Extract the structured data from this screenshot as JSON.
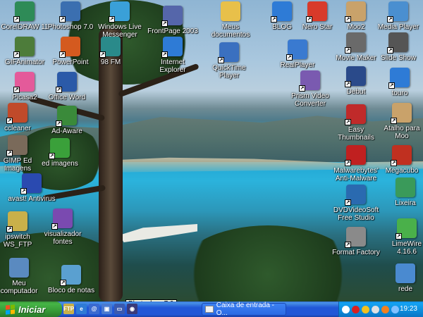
{
  "desktop": {
    "icons": [
      {
        "label": "CorelDRAW 11",
        "icon": "coreldraw-icon",
        "color": "#2e8b57"
      },
      {
        "label": "Photoshop 7.0",
        "icon": "photoshop-icon",
        "color": "#3b6fb0"
      },
      {
        "label": "Windows Live\nMessenger",
        "icon": "messenger-icon",
        "color": "#3aa0d8"
      },
      {
        "label": "FrontPage 2003",
        "icon": "frontpage-icon",
        "color": "#5566aa"
      },
      {
        "label": "Meus\ndocumentos",
        "icon": "folder-icon",
        "color": "#e8c04a"
      },
      {
        "label": "BLOG",
        "icon": "ie-icon",
        "color": "#2e7bd6"
      },
      {
        "label": "Nero Star",
        "icon": "nero-icon",
        "color": "#d83a2a"
      },
      {
        "label": "Moo2",
        "icon": "cow-icon",
        "color": "#c9a26a"
      },
      {
        "label": "Media Player",
        "icon": "media-player-icon",
        "color": "#4a8fd0"
      },
      {
        "label": "GIFAnimator",
        "icon": "gifanimator-icon",
        "color": "#4d7c3a"
      },
      {
        "label": "PowerPoint",
        "icon": "powerpoint-icon",
        "color": "#d45a1f"
      },
      {
        "label": "98 FM",
        "icon": "radio-icon",
        "color": "#2a8a8a"
      },
      {
        "label": "Internet\nExplorer",
        "icon": "internet-explorer-icon",
        "color": "#2e7bd6"
      },
      {
        "label": "QuickTime\nPlayer",
        "icon": "quicktime-icon",
        "color": "#3a70c0"
      },
      {
        "label": "RealPlayer",
        "icon": "realplayer-icon",
        "color": "#3a7ad0"
      },
      {
        "label": "Movie Maker",
        "icon": "movie-maker-icon",
        "color": "#6a6a6a"
      },
      {
        "label": "Slide Show",
        "icon": "slideshow-icon",
        "color": "#555555"
      },
      {
        "label": "Picasa2",
        "icon": "picasa-icon",
        "color": "#e45a9a"
      },
      {
        "label": "Office Word",
        "icon": "word-icon",
        "color": "#2b5aa8"
      },
      {
        "label": "Prism Video\nConverter",
        "icon": "prism-icon",
        "color": "#7a5ab0"
      },
      {
        "label": "Debut",
        "icon": "debut-icon",
        "color": "#2a4a8a"
      },
      {
        "label": "touro",
        "icon": "ie-icon",
        "color": "#2e7bd6"
      },
      {
        "label": "ccleaner",
        "icon": "ccleaner-icon",
        "color": "#c04a2a"
      },
      {
        "label": "Ad-Aware",
        "icon": "adaware-icon",
        "color": "#3a8a3a"
      },
      {
        "label": "Easy\nThumbnails",
        "icon": "thumbnails-icon",
        "color": "#c02a2a"
      },
      {
        "label": "Atalho para\nMoo",
        "icon": "cow-icon",
        "color": "#c9a26a"
      },
      {
        "label": "GIMP Ed\nImagens",
        "icon": "gimp-icon",
        "color": "#7a6a5a"
      },
      {
        "label": "ed imagens",
        "icon": "ed-imagens-icon",
        "color": "#3aa03a"
      },
      {
        "label": "Malwarebytes'\nAnti-Malware",
        "icon": "malwarebytes-icon",
        "color": "#c02020"
      },
      {
        "label": "Megacubo",
        "icon": "megacubo-icon",
        "color": "#c03020"
      },
      {
        "label": "avast! Antivirus",
        "icon": "avast-icon",
        "color": "#2a4ab0"
      },
      {
        "label": "DVDVideoSoft\nFree Studio",
        "icon": "dvdvideosoft-icon",
        "color": "#2a6ab0"
      },
      {
        "label": "Lixeira",
        "icon": "recycle-bin-icon",
        "color": "#3a9a5a"
      },
      {
        "label": "ipswitch\nWS_FTP",
        "icon": "ftp-icon",
        "color": "#c9b04a"
      },
      {
        "label": "visualizador\nfontes",
        "icon": "fonts-viewer-icon",
        "color": "#7a4ab0"
      },
      {
        "label": "Format Factory",
        "icon": "format-factory-icon",
        "color": "#8a8a8a"
      },
      {
        "label": "LimeWire\n4.16.6",
        "icon": "limewire-icon",
        "color": "#4ab04a"
      },
      {
        "label": "Meu\ncomputador",
        "icon": "my-computer-icon",
        "color": "#5a8ac0"
      },
      {
        "label": "Bloco de notas",
        "icon": "notepad-icon",
        "color": "#5aa0d0"
      },
      {
        "label": "rede",
        "icon": "network-icon",
        "color": "#4a8ad0"
      }
    ]
  },
  "taskbar": {
    "start_label": "Iniciar",
    "task_label": "Caixa de entrada - O...",
    "clock": "19:23",
    "tooltip": "Photoshop 7.0",
    "quicklaunch": [
      {
        "icon": "ftp-quicklaunch-icon",
        "text": "FTP",
        "color": "#c9b04a"
      },
      {
        "icon": "ie-quicklaunch-icon",
        "text": "e",
        "color": "#2e7bd6"
      },
      {
        "icon": "outlook-quicklaunch-icon",
        "text": "@",
        "color": "#3a6ad0"
      },
      {
        "icon": "window-quicklaunch-icon",
        "text": "▣",
        "color": "#4a7ad0"
      },
      {
        "icon": "desktop-quicklaunch-icon",
        "text": "▭",
        "color": "#3a5ab0"
      },
      {
        "icon": "media-quicklaunch-icon",
        "text": "◉",
        "color": "#3a3a7a"
      }
    ],
    "tray_icons": [
      {
        "icon": "tray-arrow-icon",
        "color": "#ffffff"
      },
      {
        "icon": "tray-shield-icon",
        "color": "#d82020"
      },
      {
        "icon": "tray-security-icon",
        "color": "#f0c020"
      },
      {
        "icon": "tray-volume-icon",
        "color": "#e0e0e0"
      },
      {
        "icon": "tray-avast-icon",
        "color": "#f08020"
      },
      {
        "icon": "tray-network-icon",
        "color": "#80c0ff"
      }
    ]
  }
}
